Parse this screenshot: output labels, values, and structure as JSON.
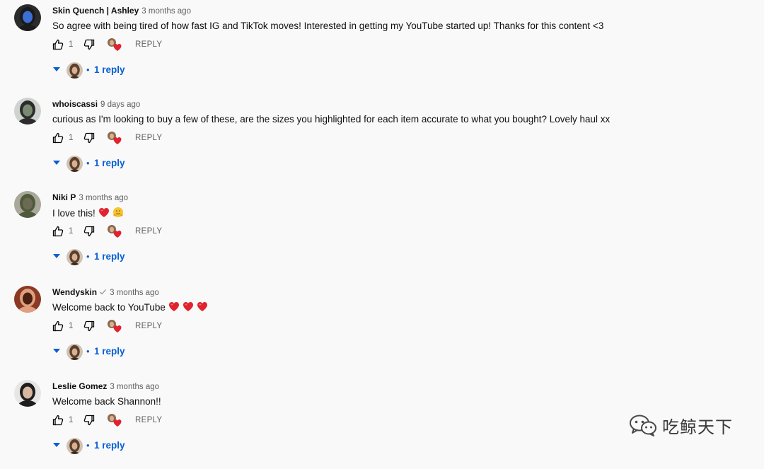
{
  "comments": [
    {
      "author": "Skin Quench | Ashley",
      "time": "3 months ago",
      "verified": false,
      "text": "So agree with being tired of how fast IG and TikTok moves! Interested in getting my YouTube started up! Thanks for this content <3",
      "hearts": 0,
      "hug": false,
      "likes": "1",
      "reply_label": "REPLY",
      "reply_count": "1 reply",
      "avatar_colors": [
        "#2b2b2b",
        "#1a1a1a",
        "#3b6fd4"
      ]
    },
    {
      "author": "whoiscassi",
      "time": "9 days ago",
      "verified": false,
      "text": "curious as I'm looking to buy a few of these, are the sizes you highlighted for each item accurate to what you bought? Lovely haul xx",
      "hearts": 0,
      "hug": false,
      "likes": "1",
      "reply_label": "REPLY",
      "reply_count": "1 reply",
      "avatar_colors": [
        "#cfd3cf",
        "#2c2c2c",
        "#7a8a70"
      ]
    },
    {
      "author": "Niki P",
      "time": "3 months ago",
      "verified": false,
      "text": "I love this!",
      "hearts": 1,
      "hug": true,
      "likes": "1",
      "reply_label": "REPLY",
      "reply_count": "1 reply",
      "avatar_colors": [
        "#a9a89a",
        "#4f5a3a",
        "#6b6b55"
      ]
    },
    {
      "author": "Wendyskin",
      "time": "3 months ago",
      "verified": true,
      "text": "Welcome back to YouTube",
      "hearts": 3,
      "hug": false,
      "likes": "1",
      "reply_label": "REPLY",
      "reply_count": "1 reply",
      "avatar_colors": [
        "#8a3a22",
        "#e0a080",
        "#4a2010"
      ]
    },
    {
      "author": "Leslie Gomez",
      "time": "3 months ago",
      "verified": false,
      "text": "Welcome back Shannon!!",
      "hearts": 0,
      "hug": false,
      "likes": "1",
      "reply_label": "REPLY",
      "reply_count": "1 reply",
      "avatar_colors": [
        "#e8e6e4",
        "#1e1e1e",
        "#d9b8a0"
      ]
    }
  ],
  "watermark": {
    "text": "吃鲸天下"
  },
  "colors": {
    "link_blue": "#065fd4",
    "heart_red": "#e0232e",
    "meta_gray": "#606060"
  }
}
